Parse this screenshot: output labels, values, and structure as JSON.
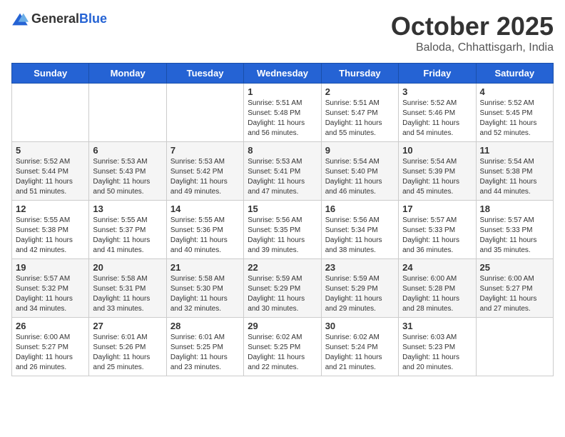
{
  "logo": {
    "general": "General",
    "blue": "Blue"
  },
  "title": "October 2025",
  "location": "Baloda, Chhattisgarh, India",
  "days_of_week": [
    "Sunday",
    "Monday",
    "Tuesday",
    "Wednesday",
    "Thursday",
    "Friday",
    "Saturday"
  ],
  "weeks": [
    [
      {
        "day": "",
        "info": ""
      },
      {
        "day": "",
        "info": ""
      },
      {
        "day": "",
        "info": ""
      },
      {
        "day": "1",
        "info": "Sunrise: 5:51 AM\nSunset: 5:48 PM\nDaylight: 11 hours\nand 56 minutes."
      },
      {
        "day": "2",
        "info": "Sunrise: 5:51 AM\nSunset: 5:47 PM\nDaylight: 11 hours\nand 55 minutes."
      },
      {
        "day": "3",
        "info": "Sunrise: 5:52 AM\nSunset: 5:46 PM\nDaylight: 11 hours\nand 54 minutes."
      },
      {
        "day": "4",
        "info": "Sunrise: 5:52 AM\nSunset: 5:45 PM\nDaylight: 11 hours\nand 52 minutes."
      }
    ],
    [
      {
        "day": "5",
        "info": "Sunrise: 5:52 AM\nSunset: 5:44 PM\nDaylight: 11 hours\nand 51 minutes."
      },
      {
        "day": "6",
        "info": "Sunrise: 5:53 AM\nSunset: 5:43 PM\nDaylight: 11 hours\nand 50 minutes."
      },
      {
        "day": "7",
        "info": "Sunrise: 5:53 AM\nSunset: 5:42 PM\nDaylight: 11 hours\nand 49 minutes."
      },
      {
        "day": "8",
        "info": "Sunrise: 5:53 AM\nSunset: 5:41 PM\nDaylight: 11 hours\nand 47 minutes."
      },
      {
        "day": "9",
        "info": "Sunrise: 5:54 AM\nSunset: 5:40 PM\nDaylight: 11 hours\nand 46 minutes."
      },
      {
        "day": "10",
        "info": "Sunrise: 5:54 AM\nSunset: 5:39 PM\nDaylight: 11 hours\nand 45 minutes."
      },
      {
        "day": "11",
        "info": "Sunrise: 5:54 AM\nSunset: 5:38 PM\nDaylight: 11 hours\nand 44 minutes."
      }
    ],
    [
      {
        "day": "12",
        "info": "Sunrise: 5:55 AM\nSunset: 5:38 PM\nDaylight: 11 hours\nand 42 minutes."
      },
      {
        "day": "13",
        "info": "Sunrise: 5:55 AM\nSunset: 5:37 PM\nDaylight: 11 hours\nand 41 minutes."
      },
      {
        "day": "14",
        "info": "Sunrise: 5:55 AM\nSunset: 5:36 PM\nDaylight: 11 hours\nand 40 minutes."
      },
      {
        "day": "15",
        "info": "Sunrise: 5:56 AM\nSunset: 5:35 PM\nDaylight: 11 hours\nand 39 minutes."
      },
      {
        "day": "16",
        "info": "Sunrise: 5:56 AM\nSunset: 5:34 PM\nDaylight: 11 hours\nand 38 minutes."
      },
      {
        "day": "17",
        "info": "Sunrise: 5:57 AM\nSunset: 5:33 PM\nDaylight: 11 hours\nand 36 minutes."
      },
      {
        "day": "18",
        "info": "Sunrise: 5:57 AM\nSunset: 5:33 PM\nDaylight: 11 hours\nand 35 minutes."
      }
    ],
    [
      {
        "day": "19",
        "info": "Sunrise: 5:57 AM\nSunset: 5:32 PM\nDaylight: 11 hours\nand 34 minutes."
      },
      {
        "day": "20",
        "info": "Sunrise: 5:58 AM\nSunset: 5:31 PM\nDaylight: 11 hours\nand 33 minutes."
      },
      {
        "day": "21",
        "info": "Sunrise: 5:58 AM\nSunset: 5:30 PM\nDaylight: 11 hours\nand 32 minutes."
      },
      {
        "day": "22",
        "info": "Sunrise: 5:59 AM\nSunset: 5:29 PM\nDaylight: 11 hours\nand 30 minutes."
      },
      {
        "day": "23",
        "info": "Sunrise: 5:59 AM\nSunset: 5:29 PM\nDaylight: 11 hours\nand 29 minutes."
      },
      {
        "day": "24",
        "info": "Sunrise: 6:00 AM\nSunset: 5:28 PM\nDaylight: 11 hours\nand 28 minutes."
      },
      {
        "day": "25",
        "info": "Sunrise: 6:00 AM\nSunset: 5:27 PM\nDaylight: 11 hours\nand 27 minutes."
      }
    ],
    [
      {
        "day": "26",
        "info": "Sunrise: 6:00 AM\nSunset: 5:27 PM\nDaylight: 11 hours\nand 26 minutes."
      },
      {
        "day": "27",
        "info": "Sunrise: 6:01 AM\nSunset: 5:26 PM\nDaylight: 11 hours\nand 25 minutes."
      },
      {
        "day": "28",
        "info": "Sunrise: 6:01 AM\nSunset: 5:25 PM\nDaylight: 11 hours\nand 23 minutes."
      },
      {
        "day": "29",
        "info": "Sunrise: 6:02 AM\nSunset: 5:25 PM\nDaylight: 11 hours\nand 22 minutes."
      },
      {
        "day": "30",
        "info": "Sunrise: 6:02 AM\nSunset: 5:24 PM\nDaylight: 11 hours\nand 21 minutes."
      },
      {
        "day": "31",
        "info": "Sunrise: 6:03 AM\nSunset: 5:23 PM\nDaylight: 11 hours\nand 20 minutes."
      },
      {
        "day": "",
        "info": ""
      }
    ]
  ]
}
